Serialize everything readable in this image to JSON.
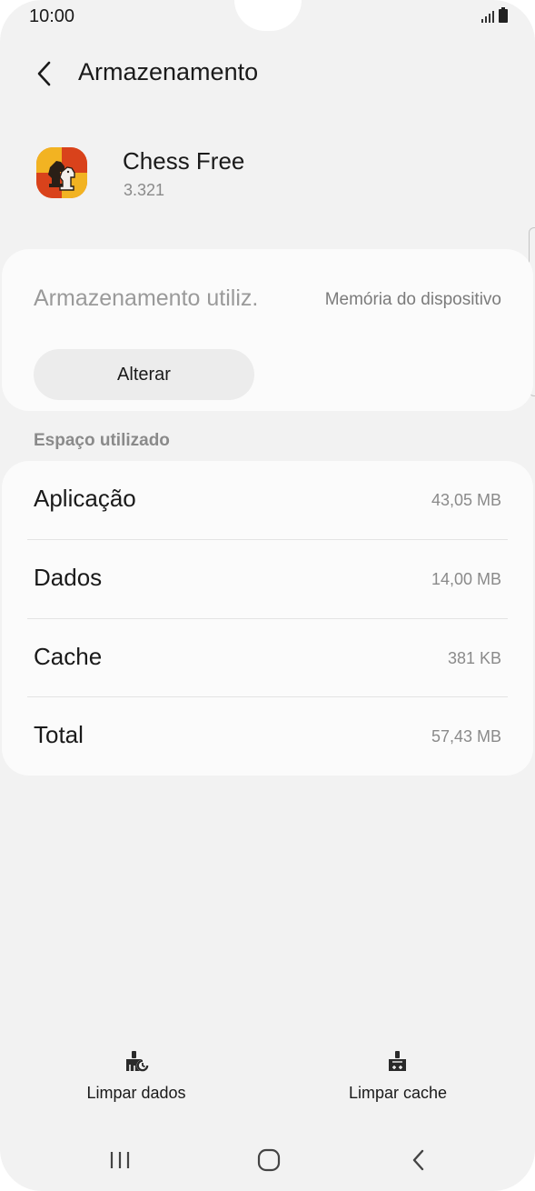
{
  "status_bar": {
    "time": "10:00",
    "icons": [
      "signal-icon",
      "battery-icon"
    ]
  },
  "header": {
    "title": "Armazenamento",
    "back_icon": "chevron-left-icon"
  },
  "app": {
    "name": "Chess Free",
    "version": "3.321",
    "icon": "chess-app-icon"
  },
  "storage": {
    "label": "Armazenamento utiliz.",
    "value": "Memória do dispositivo",
    "change_button": "Alterar"
  },
  "space_used": {
    "section_title": "Espaço utilizado",
    "rows": [
      {
        "label": "Aplicação",
        "value": "43,05 MB"
      },
      {
        "label": "Dados",
        "value": "14,00 MB"
      },
      {
        "label": "Cache",
        "value": "381 KB"
      },
      {
        "label": "Total",
        "value": "57,43 MB"
      }
    ]
  },
  "actions": {
    "clear_data": "Limpar dados",
    "clear_cache": "Limpar cache"
  },
  "nav": {
    "icons": [
      "recents-icon",
      "home-icon",
      "back-icon"
    ]
  },
  "colors": {
    "background": "#f2f2f2",
    "card": "#fbfbfb",
    "button": "#ececec",
    "text": "#1a1a1a",
    "secondary_text": "#8a8a8a"
  }
}
